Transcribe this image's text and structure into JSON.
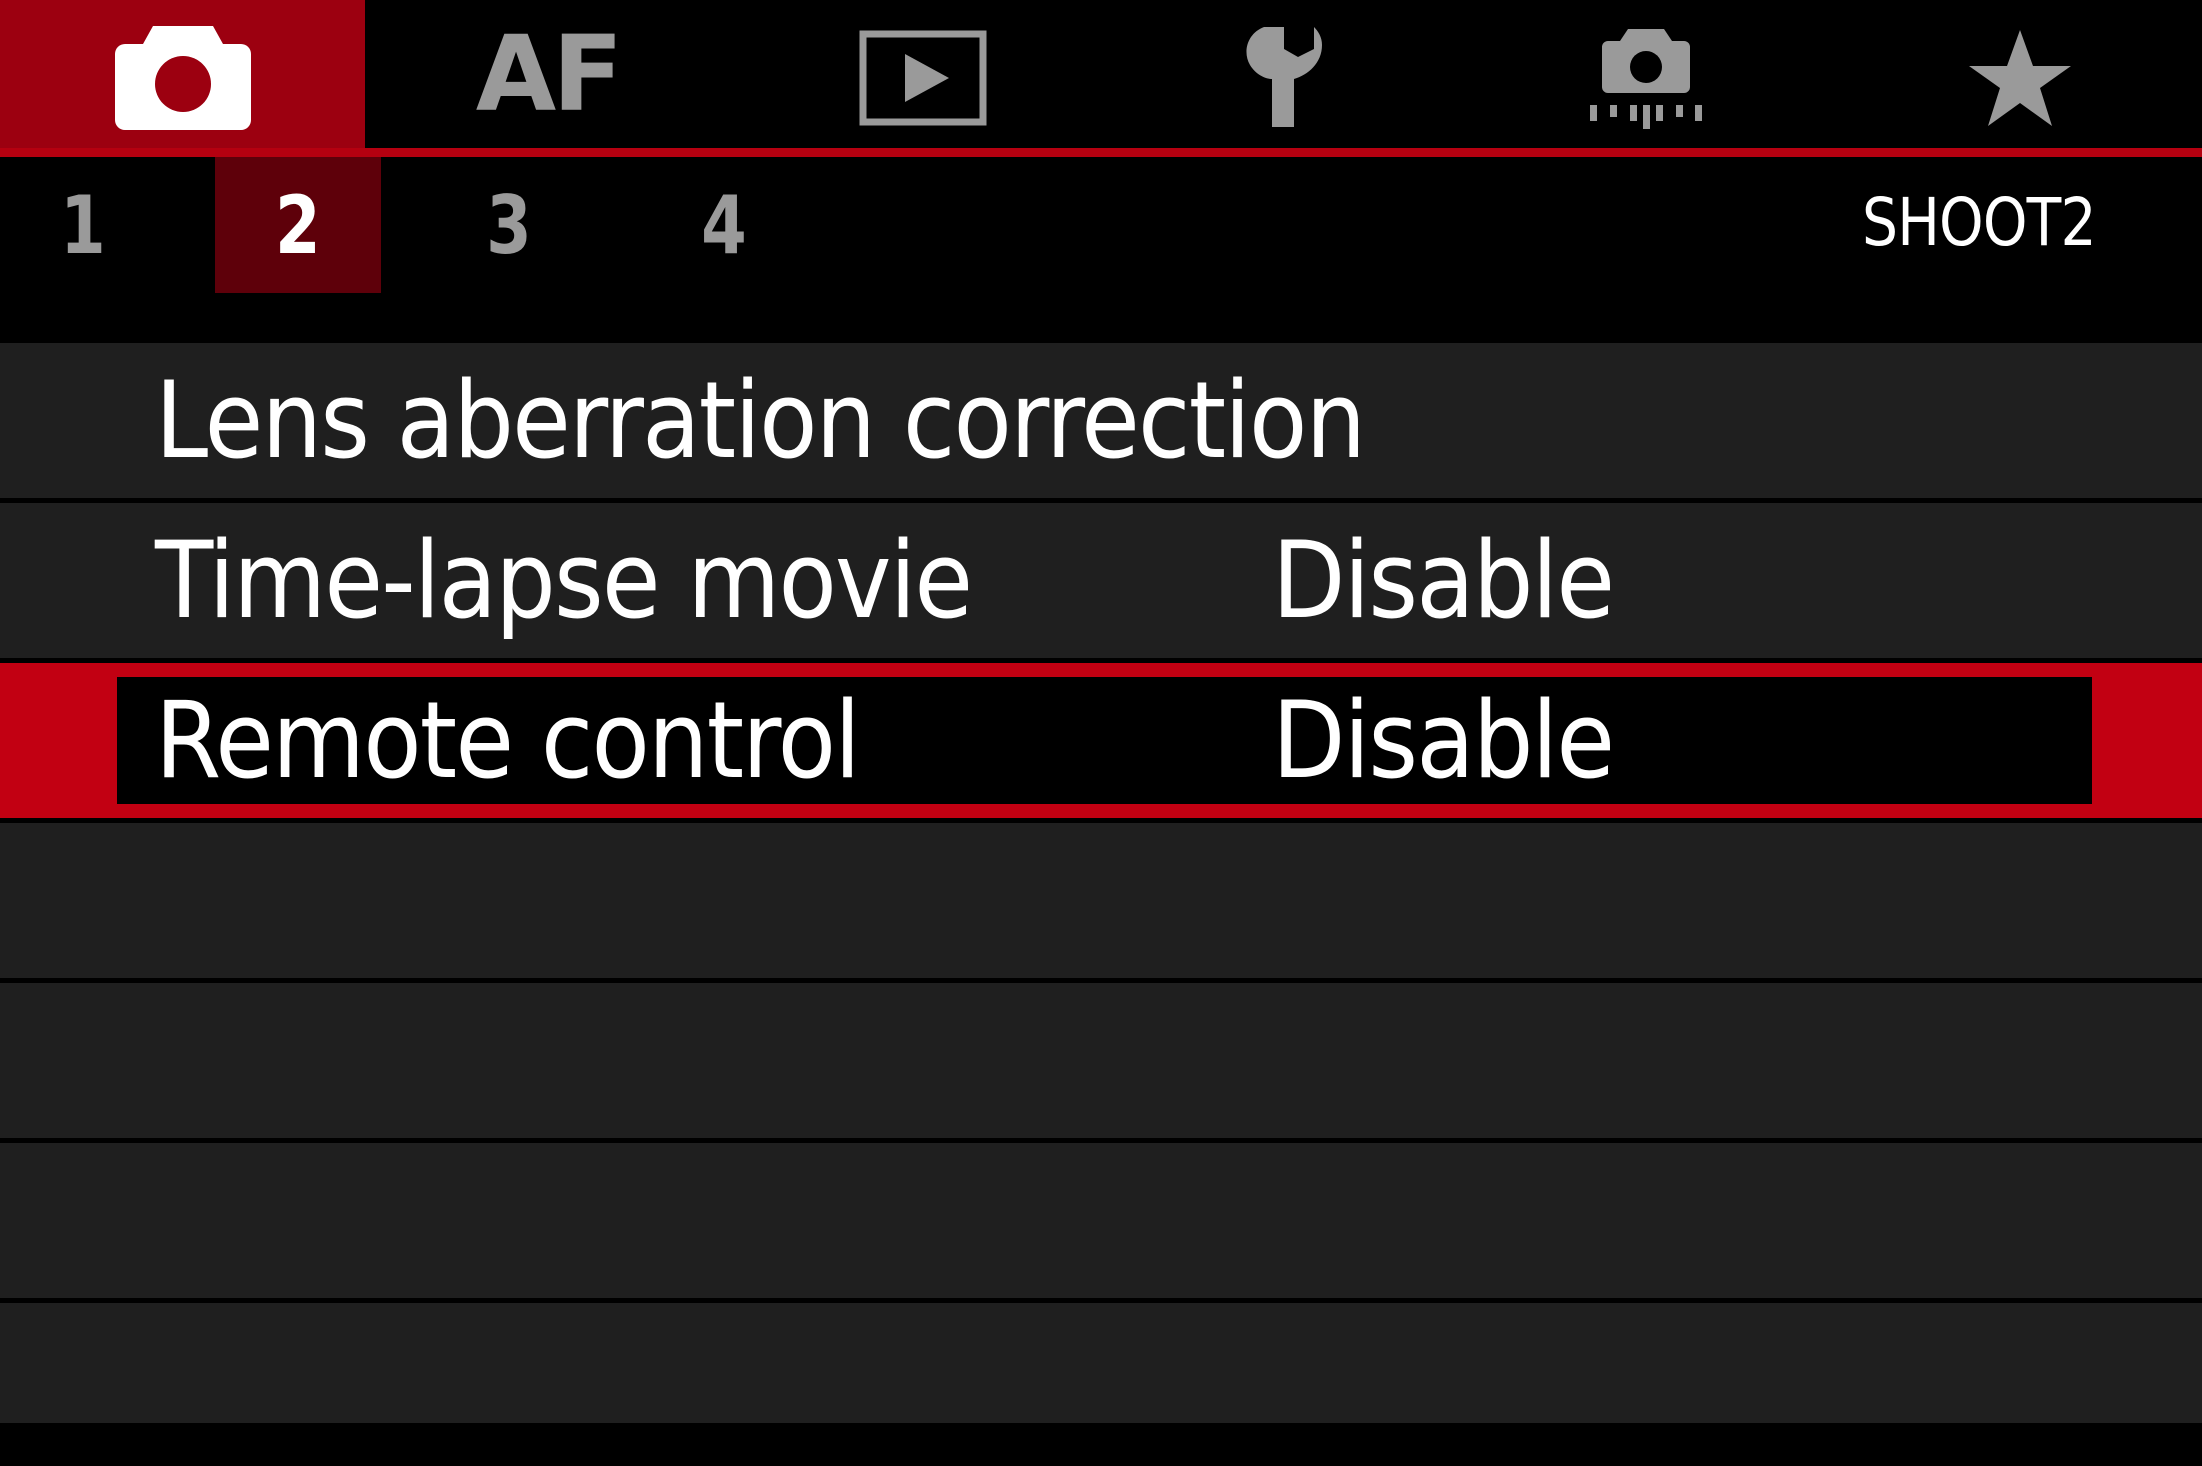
{
  "tabs": [
    {
      "id": "shooting",
      "icon": "camera-icon",
      "active": true
    },
    {
      "id": "af",
      "label": "AF",
      "active": false
    },
    {
      "id": "playback",
      "icon": "play-icon",
      "active": false
    },
    {
      "id": "setup",
      "icon": "wrench-icon",
      "active": false
    },
    {
      "id": "custom-functions",
      "icon": "custom-camera-icon",
      "active": false
    },
    {
      "id": "my-menu",
      "icon": "star-icon",
      "active": false
    }
  ],
  "pages": {
    "numbers": [
      "1",
      "2",
      "3",
      "4"
    ],
    "active_index": 1,
    "menu_name": "SHOOT2"
  },
  "menu": {
    "items": [
      {
        "label": "Lens aberration correction",
        "value": ""
      },
      {
        "label": "Time-lapse movie",
        "value": "Disable"
      },
      {
        "label": "Remote control",
        "value": "Disable",
        "selected": true
      },
      {
        "label": "",
        "value": ""
      },
      {
        "label": "",
        "value": ""
      },
      {
        "label": "",
        "value": ""
      },
      {
        "label": "",
        "value": ""
      }
    ]
  },
  "colors": {
    "accent_red": "#c20012",
    "active_tab_red": "#9c0010",
    "active_page_red": "#5e000a",
    "row_background": "#1f1f1f",
    "inactive_icon_gray": "#9a9a9a"
  }
}
